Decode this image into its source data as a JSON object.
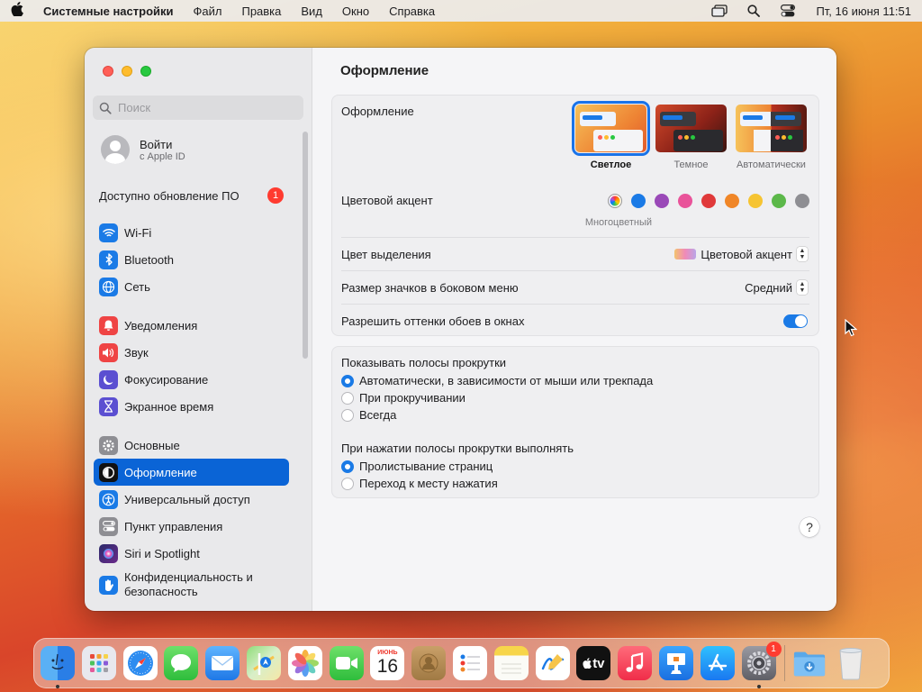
{
  "menubar": {
    "app_name": "Системные настройки",
    "menus": [
      "Файл",
      "Правка",
      "Вид",
      "Окно",
      "Справка"
    ],
    "clock": "Пт, 16 июня  11:51"
  },
  "sidebar": {
    "search_placeholder": "Поиск",
    "account": {
      "name": "Войти",
      "sub": "с Apple ID"
    },
    "update": {
      "label": "Доступно обновление ПО",
      "badge": "1"
    },
    "groups": [
      [
        {
          "label": "Wi-Fi",
          "icon": "wifi-icon"
        },
        {
          "label": "Bluetooth",
          "icon": "bluetooth-icon"
        },
        {
          "label": "Сеть",
          "icon": "globe-icon"
        }
      ],
      [
        {
          "label": "Уведомления",
          "icon": "bell-icon"
        },
        {
          "label": "Звук",
          "icon": "speaker-icon"
        },
        {
          "label": "Фокусирование",
          "icon": "moon-icon"
        },
        {
          "label": "Экранное время",
          "icon": "hourglass-icon"
        }
      ],
      [
        {
          "label": "Основные",
          "icon": "gear-icon"
        },
        {
          "label": "Оформление",
          "icon": "appearance-icon",
          "selected": true
        },
        {
          "label": "Универсальный доступ",
          "icon": "accessibility-icon"
        },
        {
          "label": "Пункт управления",
          "icon": "control-center-icon"
        },
        {
          "label": "Siri и Spotlight",
          "icon": "siri-icon"
        },
        {
          "label": "Конфиденциальность и безопасность",
          "icon": "hand-icon"
        }
      ]
    ]
  },
  "main": {
    "title": "Оформление",
    "appearance": {
      "label": "Оформление",
      "options": [
        "Светлое",
        "Темное",
        "Автоматически"
      ],
      "selected": "Светлое"
    },
    "accent": {
      "label": "Цветовой акцент",
      "colors": [
        "#c86be2",
        "#1a7ae6",
        "#9a49b8",
        "#e9539a",
        "#e0393a",
        "#f08628",
        "#f6c432",
        "#5cb84a",
        "#8e8e93"
      ],
      "selected_name": "Многоцветный"
    },
    "highlight": {
      "label": "Цвет выделения",
      "value": "Цветовой акцент"
    },
    "sidebar_icon_size": {
      "label": "Размер значков в боковом меню",
      "value": "Средний"
    },
    "wallpaper_tint": {
      "label": "Разрешить оттенки обоев в окнах",
      "on": true
    },
    "scrollbars": {
      "label": "Показывать полосы прокрутки",
      "options": [
        "Автоматически, в зависимости от мыши или трекпада",
        "При прокручивании",
        "Всегда"
      ],
      "selected_index": 0
    },
    "click_scrollbar": {
      "label": "При нажатии полосы прокрутки выполнять",
      "options": [
        "Пролистывание страниц",
        "Переход к месту нажатия"
      ],
      "selected_index": 0
    },
    "help": "?"
  },
  "dock": {
    "apps": [
      "Finder",
      "Launchpad",
      "Safari",
      "Сообщения",
      "Почта",
      "Карты",
      "Фото",
      "FaceTime",
      "Календарь",
      "Контакты",
      "Напоминания",
      "Заметки",
      "Freeform",
      "TV",
      "Музыка",
      "Keynote",
      "App Store",
      "Системные настройки"
    ],
    "calendar": {
      "month": "ИЮНЬ",
      "day": "16"
    },
    "tv_label": "tv",
    "settings_badge": "1"
  }
}
